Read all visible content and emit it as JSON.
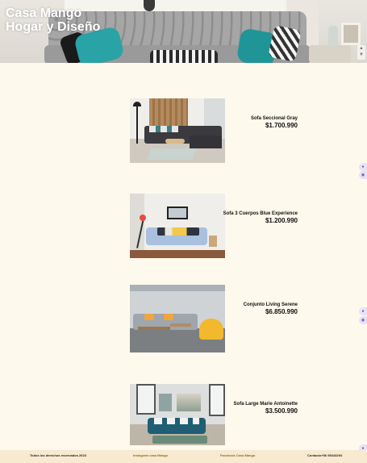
{
  "hero": {
    "title_line1": "Casa Mango",
    "title_line2": "Hogar y Diseño"
  },
  "products": [
    {
      "name": "Sofa Seccional Gray",
      "price": "$1.700.990"
    },
    {
      "name": "Sofa 3 Cuerpos Blue Experience",
      "price": "$1.200.990"
    },
    {
      "name": "Conjunto Living Serene",
      "price": "$6.850.990"
    },
    {
      "name": "Sofa Large Marie Antoinette",
      "price": "$3.500.990"
    }
  ],
  "footer": {
    "copyright": "Todos los derechos reservados 2023",
    "instagram": "Instagram casa Mango",
    "facebook": "Facebook Casa Mango",
    "contact": "Contacto+56 95443294"
  },
  "colors": {
    "page_background": "#fdf9ec",
    "footer_background": "#f7ead0",
    "link_color": "#8a6c2e"
  }
}
